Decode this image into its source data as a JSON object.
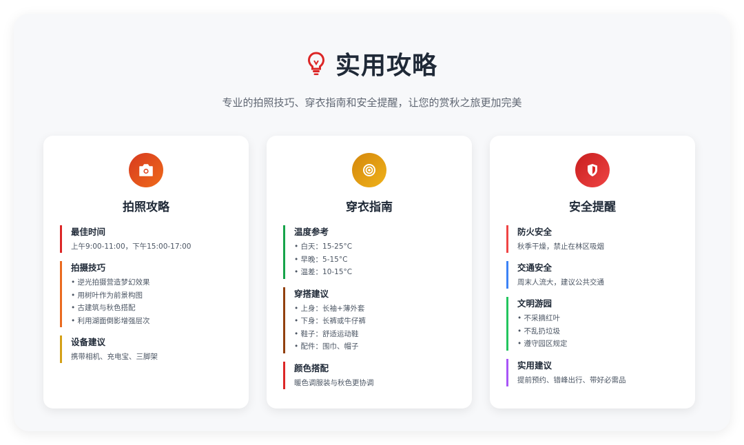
{
  "header": {
    "icon": "lightbulb-icon",
    "title": "实用攻略",
    "subtitle": "专业的拍照技巧、穿衣指南和安全提醒，让您的赏秋之旅更加完美"
  },
  "cards": [
    {
      "icon": "camera-icon",
      "icon_color": "#e0451f",
      "title": "拍照攻略",
      "sections": [
        {
          "title": "最佳时间",
          "text": "上午9:00-11:00，下午15:00-17:00",
          "color": "#dc2626"
        },
        {
          "title": "拍摄技巧",
          "items": [
            "逆光拍摄营造梦幻效果",
            "用树叶作为前景构图",
            "古建筑与秋色搭配",
            "利用湖面倒影增强层次"
          ],
          "color": "#ea6a1f"
        },
        {
          "title": "设备建议",
          "text": "携带相机、充电宝、三脚架",
          "color": "#d4a017"
        }
      ]
    },
    {
      "icon": "target-icon",
      "icon_color": "#e0960f",
      "title": "穿衣指南",
      "sections": [
        {
          "title": "温度参考",
          "items": [
            "白天：15-25°C",
            "早晚：5-15°C",
            "温差：10-15°C"
          ],
          "color": "#16a34a"
        },
        {
          "title": "穿搭建议",
          "items": [
            "上身：长袖+薄外套",
            "下身：长裤或牛仔裤",
            "鞋子：舒适运动鞋",
            "配件：围巾、帽子"
          ],
          "color": "#92400e"
        },
        {
          "title": "颜色搭配",
          "text": "暖色调服装与秋色更协调",
          "color": "#dc2626"
        }
      ]
    },
    {
      "icon": "shield-icon",
      "icon_color": "#dc2626",
      "title": "安全提醒",
      "sections": [
        {
          "title": "防火安全",
          "text": "秋季干燥，禁止在林区吸烟",
          "color": "#ef4444"
        },
        {
          "title": "交通安全",
          "text": "周末人流大，建议公共交通",
          "color": "#3b82f6"
        },
        {
          "title": "文明游园",
          "items": [
            "不采摘红叶",
            "不乱扔垃圾",
            "遵守园区规定"
          ],
          "color": "#22c55e"
        },
        {
          "title": "实用建议",
          "text": "提前预约、错峰出行、带好必需品",
          "color": "#a855f7"
        }
      ]
    }
  ]
}
